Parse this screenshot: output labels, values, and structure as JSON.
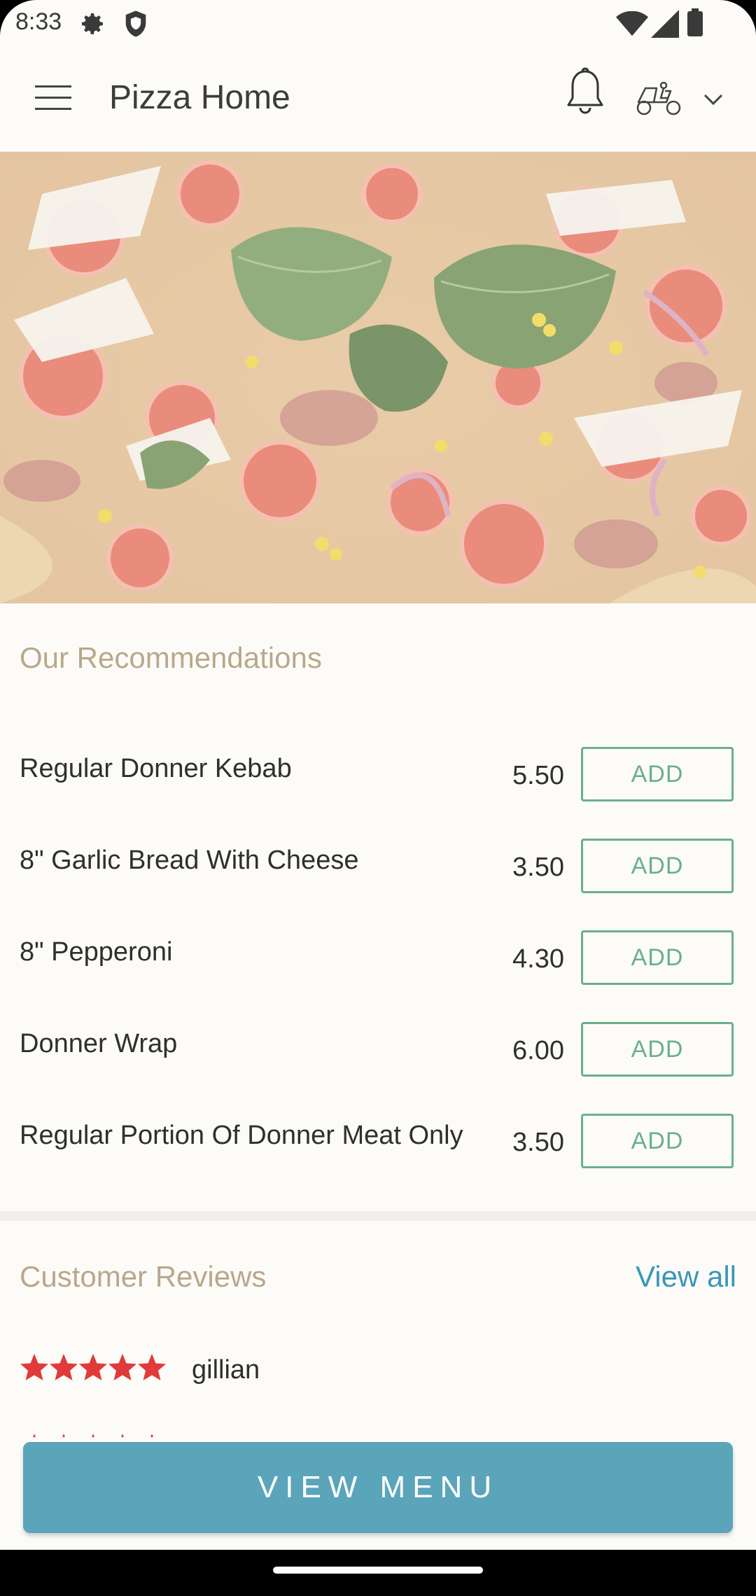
{
  "status_bar": {
    "time": "8:33"
  },
  "app_bar": {
    "title": "Pizza Home"
  },
  "recommendations": {
    "heading": "Our Recommendations",
    "add_label": "ADD",
    "items": [
      {
        "name": "Regular Donner Kebab",
        "price": "5.50"
      },
      {
        "name": "8\" Garlic Bread With Cheese",
        "price": "3.50"
      },
      {
        "name": "8\" Pepperoni",
        "price": "4.30"
      },
      {
        "name": "Donner Wrap",
        "price": "6.00"
      },
      {
        "name": "Regular Portion Of Donner Meat Only",
        "price": "3.50"
      }
    ]
  },
  "reviews": {
    "heading": "Customer Reviews",
    "view_all": "View all",
    "items": [
      {
        "name": "gillian",
        "rating": 5
      }
    ]
  },
  "footer": {
    "view_menu": "VIEW MENU"
  },
  "colors": {
    "accent_heading": "#b9a88c",
    "add_green": "#6ab08a",
    "link_blue": "#3a97b7",
    "button_teal": "#5ba5bb",
    "star_red": "#e03a3a"
  }
}
